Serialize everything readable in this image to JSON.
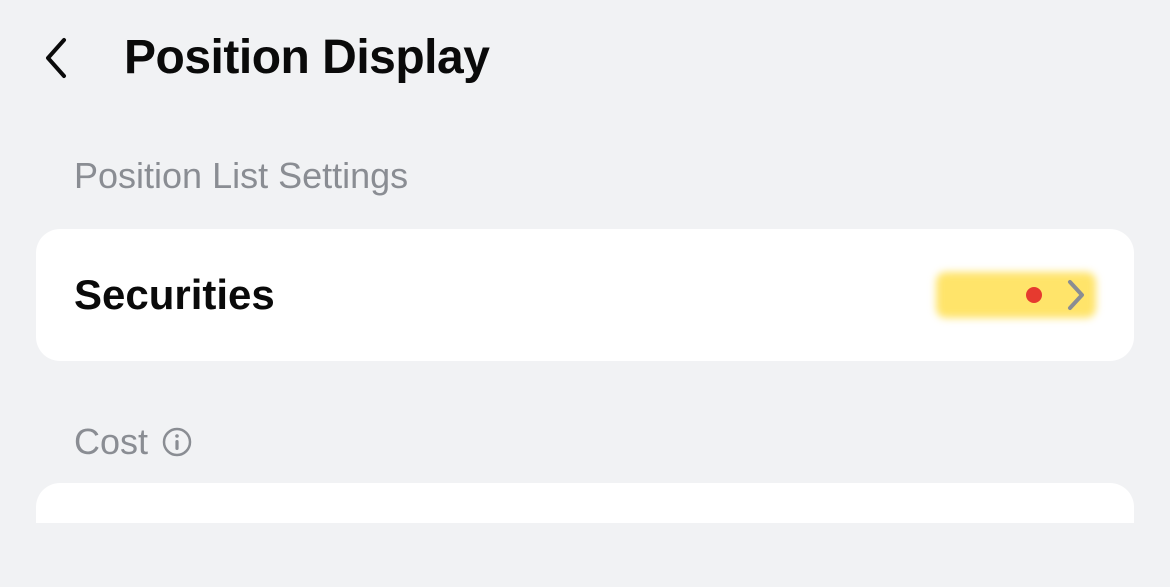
{
  "header": {
    "title": "Position Display"
  },
  "sections": {
    "position_list": {
      "label": "Position List Settings",
      "items": {
        "securities": {
          "label": "Securities",
          "has_badge": true
        }
      }
    },
    "cost": {
      "label": "Cost"
    }
  }
}
